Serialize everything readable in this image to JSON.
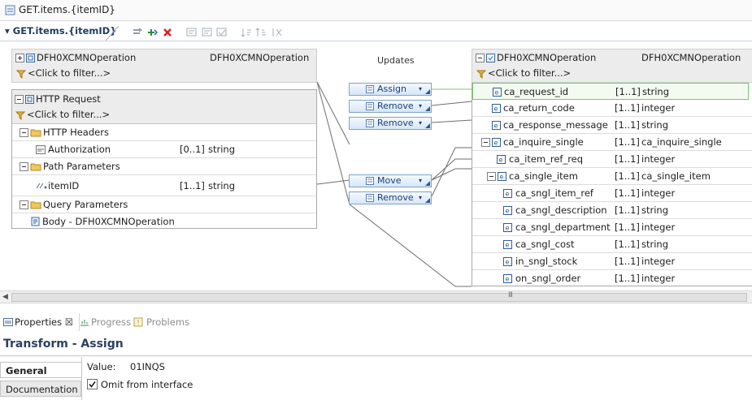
{
  "window": {
    "title": "GET.items.{itemID}"
  },
  "editor": {
    "tab_label": "▾ GET.items.{itemID}"
  },
  "toolbar": {
    "icons": [
      "add-input-icon",
      "add-output-icon",
      "delete-icon",
      "edit-icon",
      "edit-alt-icon",
      "edit-check-icon",
      "sort-icon",
      "sort-alt-icon",
      "sort-clear-icon"
    ]
  },
  "left_top": {
    "name": "DFH0XCMNOperation",
    "type": "DFH0XCMNOperation",
    "filter": "<Click to filter...>"
  },
  "updates_label": "Updates",
  "http_request": {
    "title": "HTTP Request",
    "filter": "<Click to filter...>",
    "rows": [
      {
        "label": "HTTP Headers",
        "card": "",
        "type": ""
      },
      {
        "label": "Authorization",
        "card": "[0..1]",
        "type": "string"
      },
      {
        "label": "Path Parameters",
        "card": "",
        "type": ""
      },
      {
        "label": "itemID",
        "card": "[1..1]",
        "type": "string"
      },
      {
        "label": "Query Parameters",
        "card": "",
        "type": ""
      },
      {
        "label": "Body - DFH0XCMNOperation",
        "card": "",
        "type": ""
      }
    ]
  },
  "transforms": [
    {
      "label": "Assign"
    },
    {
      "label": "Remove"
    },
    {
      "label": "Remove"
    },
    {
      "label": "Move"
    },
    {
      "label": "Remove"
    }
  ],
  "right": {
    "name": "DFH0XCMNOperation",
    "type": "DFH0XCMNOperation",
    "filter": "<Click to filter...>",
    "rows": [
      {
        "label": "ca_request_id",
        "card": "[1..1]",
        "type": "string"
      },
      {
        "label": "ca_return_code",
        "card": "[1..1]",
        "type": "integer"
      },
      {
        "label": "ca_response_message",
        "card": "[1..1]",
        "type": "string"
      },
      {
        "label": "ca_inquire_single",
        "card": "[1..1]",
        "type": "ca_inquire_single"
      },
      {
        "label": "ca_item_ref_req",
        "card": "[1..1]",
        "type": "integer"
      },
      {
        "label": "ca_single_item",
        "card": "[1..1]",
        "type": "ca_single_item"
      },
      {
        "label": "ca_sngl_item_ref",
        "card": "[1..1]",
        "type": "integer"
      },
      {
        "label": "ca_sngl_description",
        "card": "[1..1]",
        "type": "string"
      },
      {
        "label": "ca_sngl_department",
        "card": "[1..1]",
        "type": "integer"
      },
      {
        "label": "ca_sngl_cost",
        "card": "[1..1]",
        "type": "string"
      },
      {
        "label": "in_sngl_stock",
        "card": "[1..1]",
        "type": "integer"
      },
      {
        "label": "on_sngl_order",
        "card": "[1..1]",
        "type": "integer"
      }
    ]
  },
  "scrollbar": {
    "grip": "III"
  },
  "bottom": {
    "tabs": [
      {
        "label": "Properties ☒"
      },
      {
        "label": "Progress"
      },
      {
        "label": "Problems"
      }
    ],
    "title": "Transform - Assign",
    "side_tabs": [
      {
        "label": "General"
      },
      {
        "label": "Documentation"
      }
    ],
    "value_label": "Value:",
    "value": "01INQS",
    "omit_label": "Omit from interface",
    "omit_checked": true
  },
  "colors": {
    "accent": "#1f3d63",
    "selected_row_border": "#7cc473",
    "button_text": "#1b3f72",
    "link_line": "#6d6d6d"
  }
}
